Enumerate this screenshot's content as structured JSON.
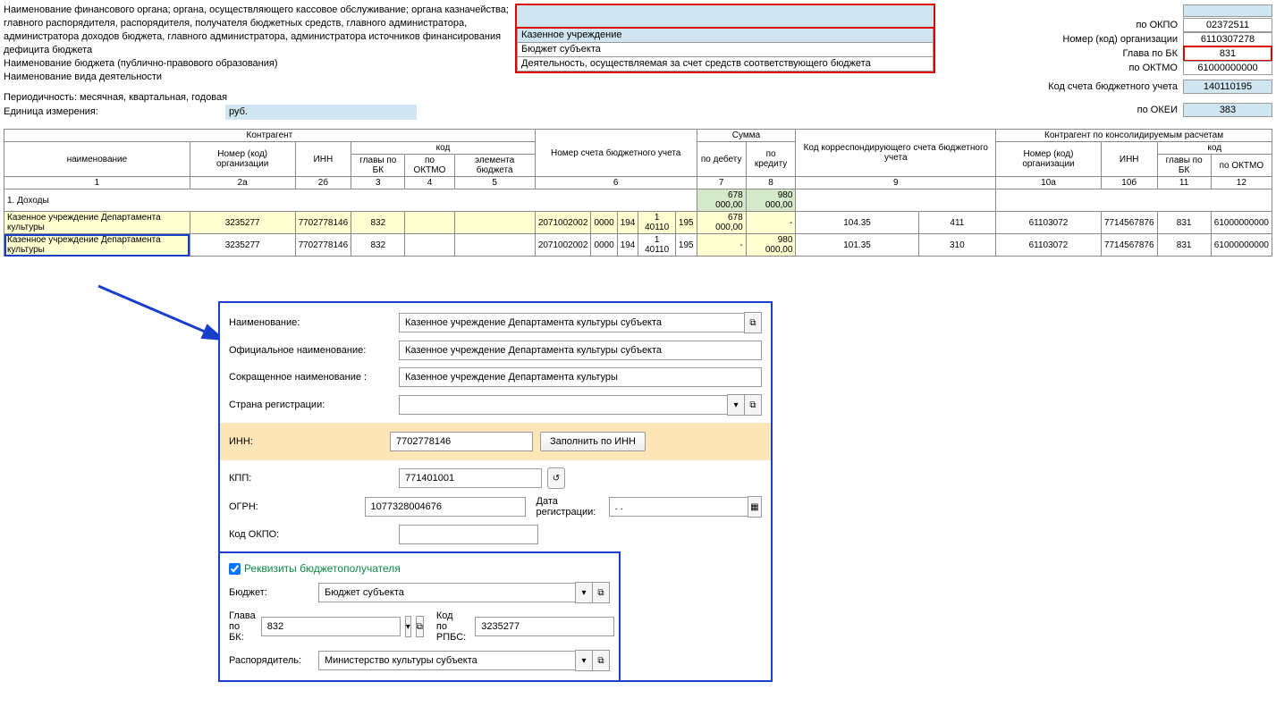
{
  "header": {
    "left_text": "Наименование финансового органа; органа, осуществляющего кассовое обслуживание; органа казначейства; главного распорядителя, распорядителя, получателя бюджетных средств, главного администратора, администратора доходов бюджета, главного администратора, администратора источников финансирования дефицита бюджета",
    "budget_label": "Наименование бюджета (публично-правового образования)",
    "activity_label": "Наименование вида деятельности",
    "period_label": "Периодичность: месячная, квартальная, годовая",
    "unit_label": "Единица измерения:",
    "unit_value": "руб.",
    "mid_org": "Казенное учреждение",
    "mid_budget": "Бюджет субъекта",
    "mid_activity": "Деятельность, осуществляемая за счет средств соответствующего бюджета"
  },
  "right_codes": {
    "okpo_label": "по ОКПО",
    "okpo": "02372511",
    "org_label": "Номер (код) организации",
    "org": "6110307278",
    "glava_label": "Глава по БК",
    "glava": "831",
    "oktmo_label": "по ОКТМО",
    "oktmo": "61000000000",
    "acc_label": "Код счета бюджетного учета",
    "acc": "140110195",
    "okei_label": "по ОКЕИ",
    "okei": "383"
  },
  "table_headers": {
    "kontragent": "Контрагент",
    "name": "наименование",
    "org_code": "Номер (код) организации",
    "inn": "ИНН",
    "code": "код",
    "glava_bk": "главы по БК",
    "oktmo": "по ОКТМО",
    "element": "элемента бюджета",
    "acc_num": "Номер счета бюджетного учета",
    "sum": "Сумма",
    "debit": "по дебету",
    "credit": "по кредиту",
    "corr": "Код корреспонди­рующего счета бюджетного учета",
    "kontragent_cons": "Контрагент по консолидируемым расчетам",
    "c1": "1",
    "c2a": "2а",
    "c2b": "2б",
    "c3": "3",
    "c4": "4",
    "c5": "5",
    "c6": "6",
    "c7": "7",
    "c8": "8",
    "c9": "9",
    "c10a": "10а",
    "c10b": "10б",
    "c11": "11",
    "c12": "12"
  },
  "section_row": "1. Доходы",
  "rows": [
    {
      "name": "Казенное учреждение Департамента культуры",
      "org": "3235277",
      "inn": "7702778146",
      "glava": "832",
      "oktmo": "",
      "elem": "",
      "acc": [
        "2071002002",
        "0000",
        "194",
        "1 40110",
        "195"
      ],
      "debit": "678 000,00",
      "credit": "-",
      "corr": [
        "104.35",
        "411"
      ],
      "cons_org": "61103072",
      "cons_inn": "7714567876",
      "cons_glava": "831",
      "cons_oktmo": "61000000000"
    },
    {
      "name": "Казенное учреждение Департамента культуры",
      "org": "3235277",
      "inn": "7702778146",
      "glava": "832",
      "oktmo": "",
      "elem": "",
      "acc": [
        "2071002002",
        "0000",
        "194",
        "1 40110",
        "195"
      ],
      "debit": "-",
      "credit": "980 000,00",
      "corr": [
        "101.35",
        "310"
      ],
      "cons_org": "61103072",
      "cons_inn": "7714567876",
      "cons_glava": "831",
      "cons_oktmo": "61000000000"
    }
  ],
  "totals": {
    "debit": "678 000,00",
    "credit": "980 000,00"
  },
  "detail": {
    "name_label": "Наименование:",
    "name": "Казенное учреждение Департамента культуры субъекта",
    "off_name_label": "Официальное наименование:",
    "off_name": "Казенное учреждение Департамента культуры субъекта",
    "short_name_label": "Сокращенное наименование :",
    "short_name": "Казенное учреждение Департамента культуры",
    "country_label": "Страна регистрации:",
    "country": "",
    "inn_label": "ИНН:",
    "inn": "7702778146",
    "fill_inn_btn": "Заполнить по ИНН",
    "kpp_label": "КПП:",
    "kpp": "771401001",
    "ogrn_label": "ОГРН:",
    "ogrn": "1077328004676",
    "regdate_label": "Дата регистрации:",
    "regdate": ". .",
    "okpo_label": "Код ОКПО:",
    "okpo": "",
    "section": "Реквизиты бюджетополучателя",
    "budget_label": "Бюджет:",
    "budget": "Бюджет субъекта",
    "glava_label": "Глава по БК:",
    "glava": "832",
    "rpbs_label": "Код по РПБС:",
    "rpbs": "3235277",
    "disposer_label": "Распорядитель:",
    "disposer": "Министерство культуры субъекта"
  },
  "icons": {
    "open": "⧉",
    "dropdown": "▾",
    "history": "↺",
    "calendar": "▦"
  }
}
